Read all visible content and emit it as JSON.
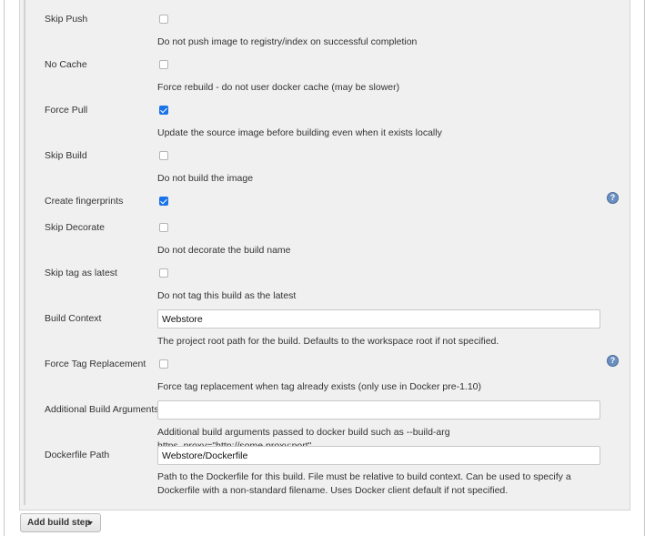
{
  "options": [
    {
      "label": "Skip Push",
      "checked": false,
      "description": "Do not push image to registry/index on successful completion"
    },
    {
      "label": "No Cache",
      "checked": false,
      "description": "Force rebuild - do not user docker cache (may be slower)"
    },
    {
      "label": "Force Pull",
      "checked": true,
      "description": "Update the source image before building even when it exists locally"
    },
    {
      "label": "Skip Build",
      "checked": false,
      "description": "Do not build the image"
    },
    {
      "label": "Create fingerprints",
      "checked": true
    },
    {
      "label": "Skip Decorate",
      "checked": false,
      "description": "Do not decorate the build name"
    },
    {
      "label": "Skip tag as latest",
      "checked": false,
      "description": "Do not tag this build as the latest"
    }
  ],
  "build_context": {
    "label": "Build Context",
    "value": "Webstore",
    "description": "The project root path for the build. Defaults to the workspace root if not specified."
  },
  "force_tag": {
    "label": "Force Tag Replacement",
    "checked": false,
    "description": "Force tag replacement when tag already exists (only use in Docker pre-1.10)"
  },
  "additional_args": {
    "label": "Additional Build Arguments",
    "value": "",
    "description": "Additional build arguments passed to docker build such as --build-arg https_proxy=\"http://some.proxy:port\""
  },
  "dockerfile_path": {
    "label": "Dockerfile Path",
    "value": "Webstore/Dockerfile",
    "description": "Path to the Dockerfile for this build. File must be relative to build context. Can be used to specify a Dockerfile with a non-standard filename. Uses Docker client default if not specified."
  },
  "help_icon": "question-mark-circle",
  "add_build_step": {
    "label": "Add build step"
  },
  "colors": {
    "checkbox_checked": "#1a73e8",
    "help_icon": "#6b8fc0",
    "section_bg": "#f0f0f0"
  }
}
